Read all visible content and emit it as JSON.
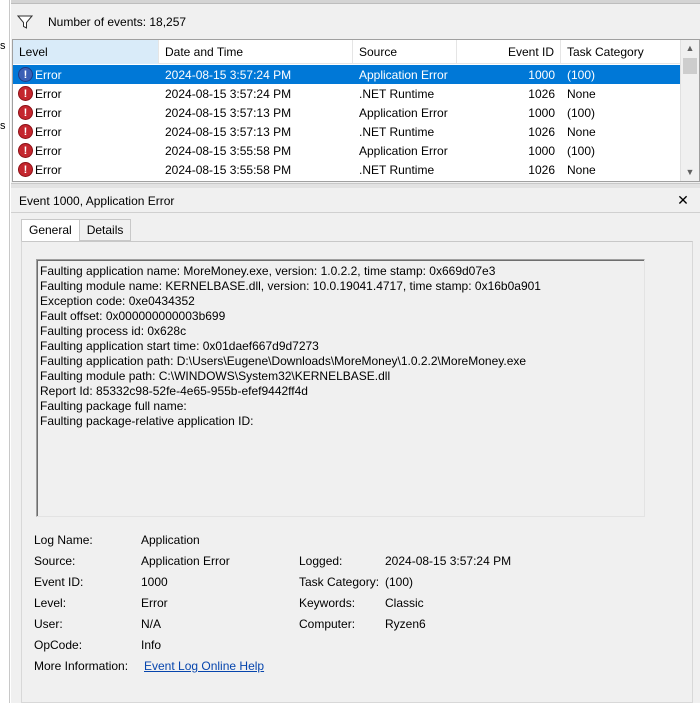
{
  "left_strip": {
    "fragments": [
      "s",
      "s"
    ]
  },
  "list": {
    "event_count_text": "Number of events: 18,257",
    "columns": [
      {
        "label": "Level"
      },
      {
        "label": "Date and Time"
      },
      {
        "label": "Source"
      },
      {
        "label": "Event ID"
      },
      {
        "label": "Task Category"
      }
    ],
    "rows": [
      {
        "level": "Error",
        "datetime": "2024-08-15 3:57:24 PM",
        "source": "Application Error",
        "event_id": "1000",
        "task_category": "(100)"
      },
      {
        "level": "Error",
        "datetime": "2024-08-15 3:57:24 PM",
        "source": ".NET Runtime",
        "event_id": "1026",
        "task_category": "None"
      },
      {
        "level": "Error",
        "datetime": "2024-08-15 3:57:13 PM",
        "source": "Application Error",
        "event_id": "1000",
        "task_category": "(100)"
      },
      {
        "level": "Error",
        "datetime": "2024-08-15 3:57:13 PM",
        "source": ".NET Runtime",
        "event_id": "1026",
        "task_category": "None"
      },
      {
        "level": "Error",
        "datetime": "2024-08-15 3:55:58 PM",
        "source": "Application Error",
        "event_id": "1000",
        "task_category": "(100)"
      },
      {
        "level": "Error",
        "datetime": "2024-08-15 3:55:58 PM",
        "source": ".NET Runtime",
        "event_id": "1026",
        "task_category": "None"
      }
    ],
    "error_glyph": "!"
  },
  "detail": {
    "title": "Event 1000, Application Error",
    "close_glyph": "✕",
    "tabs": [
      {
        "label": "General"
      },
      {
        "label": "Details"
      }
    ],
    "description_lines": [
      "Faulting application name: MoreMoney.exe, version: 1.0.2.2, time stamp: 0x669d07e3",
      "Faulting module name: KERNELBASE.dll, version: 10.0.19041.4717, time stamp: 0x16b0a901",
      "Exception code: 0xe0434352",
      "Fault offset: 0x000000000003b699",
      "Faulting process id: 0x628c",
      "Faulting application start time: 0x01daef667d9d7273",
      "Faulting application path: D:\\Users\\Eugene\\Downloads\\MoreMoney\\1.0.2.2\\MoreMoney.exe",
      "Faulting module path: C:\\WINDOWS\\System32\\KERNELBASE.dll",
      "Report Id: 85332c98-52fe-4e65-955b-efef9442ff4d",
      "Faulting package full name: ",
      "Faulting package-relative application ID: "
    ],
    "props": {
      "log_name_label": "Log Name:",
      "log_name": "Application",
      "source_label": "Source:",
      "source": "Application Error",
      "logged_label": "Logged:",
      "logged": "2024-08-15 3:57:24 PM",
      "event_id_label": "Event ID:",
      "event_id": "1000",
      "task_category_label": "Task Category:",
      "task_category": "(100)",
      "level_label": "Level:",
      "level": "Error",
      "keywords_label": "Keywords:",
      "keywords": "Classic",
      "user_label": "User:",
      "user": "N/A",
      "computer_label": "Computer:",
      "computer": "Ryzen6",
      "opcode_label": "OpCode:",
      "opcode": "Info",
      "more_info_label": "More Information:",
      "more_info_link": "Event Log Online Help"
    }
  },
  "colors": {
    "selection": "#0078d7",
    "error_icon": "#c4262e",
    "link": "#0645ad"
  }
}
